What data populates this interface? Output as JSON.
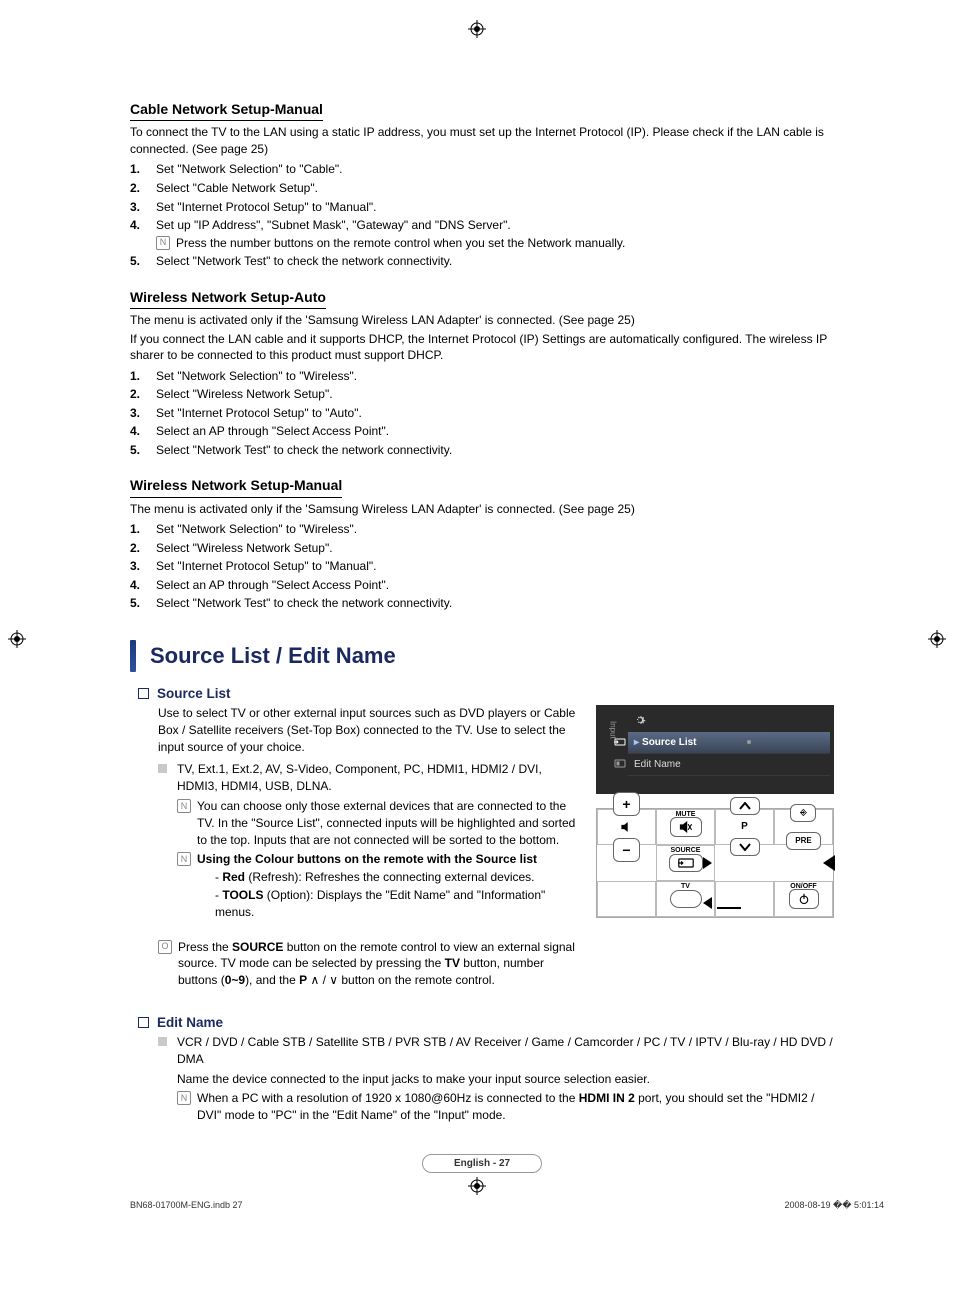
{
  "sections": {
    "cable_manual": {
      "title": "Cable Network Setup-Manual",
      "intro": "To connect the TV to the LAN using a static IP address, you must set up the Internet Protocol (IP). Please check if the LAN cable is connected. (See page 25)",
      "steps": [
        "Set \"Network Selection\" to \"Cable\".",
        "Select \"Cable Network Setup\".",
        "Set \"Internet Protocol Setup\" to \"Manual\".",
        "Set up \"IP Address\", \"Subnet Mask\", \"Gateway\" and \"DNS Server\".",
        "Select \"Network Test\" to check the network connectivity."
      ],
      "step4_note": "Press the number buttons on the remote control when you set the Network manually."
    },
    "wireless_auto": {
      "title": "Wireless Network Setup-Auto",
      "intro1": "The menu is activated only if the 'Samsung Wireless LAN Adapter' is connected. (See page 25)",
      "intro2": "If you connect the LAN cable and it supports DHCP, the Internet Protocol (IP) Settings are automatically configured. The wireless IP sharer to be connected to this product must support DHCP.",
      "steps": [
        "Set \"Network Selection\" to \"Wireless\".",
        "Select \"Wireless Network Setup\".",
        "Set \"Internet Protocol Setup\" to \"Auto\".",
        "Select an AP through \"Select Access Point\".",
        "Select \"Network Test\" to check the network connectivity."
      ]
    },
    "wireless_manual": {
      "title": "Wireless Network Setup-Manual",
      "intro": "The menu is activated only if the 'Samsung Wireless LAN Adapter' is connected. (See page 25)",
      "steps": [
        "Set \"Network Selection\" to \"Wireless\".",
        "Select \"Wireless Network Setup\".",
        "Set \"Internet Protocol Setup\" to \"Manual\".",
        "Select an AP through \"Select Access Point\".",
        "Select \"Network Test\" to check the network connectivity."
      ]
    }
  },
  "major_heading": "Source List / Edit Name",
  "source_list": {
    "heading": "Source List",
    "para1": "Use to select TV or other external input sources such as DVD players or Cable Box / Satellite receivers (Set-Top Box) connected to the TV. Use to select the input source of your choice.",
    "bullet": "TV, Ext.1, Ext.2, AV, S-Video, Component, PC, HDMI1, HDMI2 / DVI, HDMI3, HDMI4, USB, DLNA.",
    "note1": "You can choose only those external devices that are connected to the TV. In the \"Source List\", connected inputs will be highlighted and sorted to the top. Inputs that are not connected will be sorted to the bottom.",
    "note2_title": "Using the Colour buttons on the remote with the Source list",
    "note2_red_label": "Red",
    "note2_red": " (Refresh): Refreshes the connecting external devices.",
    "note2_tools_label": "TOOLS",
    "note2_tools": " (Option): Displays the \"Edit Name\" and \"Information\" menus.",
    "remote_note_pre": "Press the ",
    "remote_note_bold1": "SOURCE",
    "remote_note_mid1": " button on the remote control to view an external signal source. TV mode can be selected by pressing the ",
    "remote_note_bold2": "TV",
    "remote_note_mid2": " button, number buttons (",
    "remote_note_bold3": "0~9",
    "remote_note_mid3": "), and the ",
    "remote_note_bold4": "P",
    "remote_note_mid4": " ∧ / ∨ button on the remote control."
  },
  "osd": {
    "side_label": "Input",
    "row1": "Source List",
    "row2": "Edit Name"
  },
  "remote": {
    "mute": "MUTE",
    "p": "P",
    "source": "SOURCE",
    "tv": "TV",
    "onoff": "ON/OFF",
    "plus": "+",
    "minus": "−"
  },
  "edit_name": {
    "heading": "Edit Name",
    "bullet": "VCR / DVD / Cable STB / Satellite STB / PVR STB / AV Receiver / Game / Camcorder / PC / TV / IPTV / Blu-ray / HD DVD / DMA",
    "para": "Name the device connected to the input jacks to make your input source selection easier.",
    "note_pre": "When a PC with a resolution of 1920 x 1080@60Hz is connected to the ",
    "note_bold": "HDMI IN 2",
    "note_post": " port, you should set the \"HDMI2 / DVI\" mode to \"PC\" in the \"Edit Name\" of the \"Input\" mode."
  },
  "footer": {
    "page_label": "English - 27",
    "doc_id": "BN68-01700M-ENG.indb   27",
    "timestamp": "2008-08-19   �� 5:01:14"
  }
}
